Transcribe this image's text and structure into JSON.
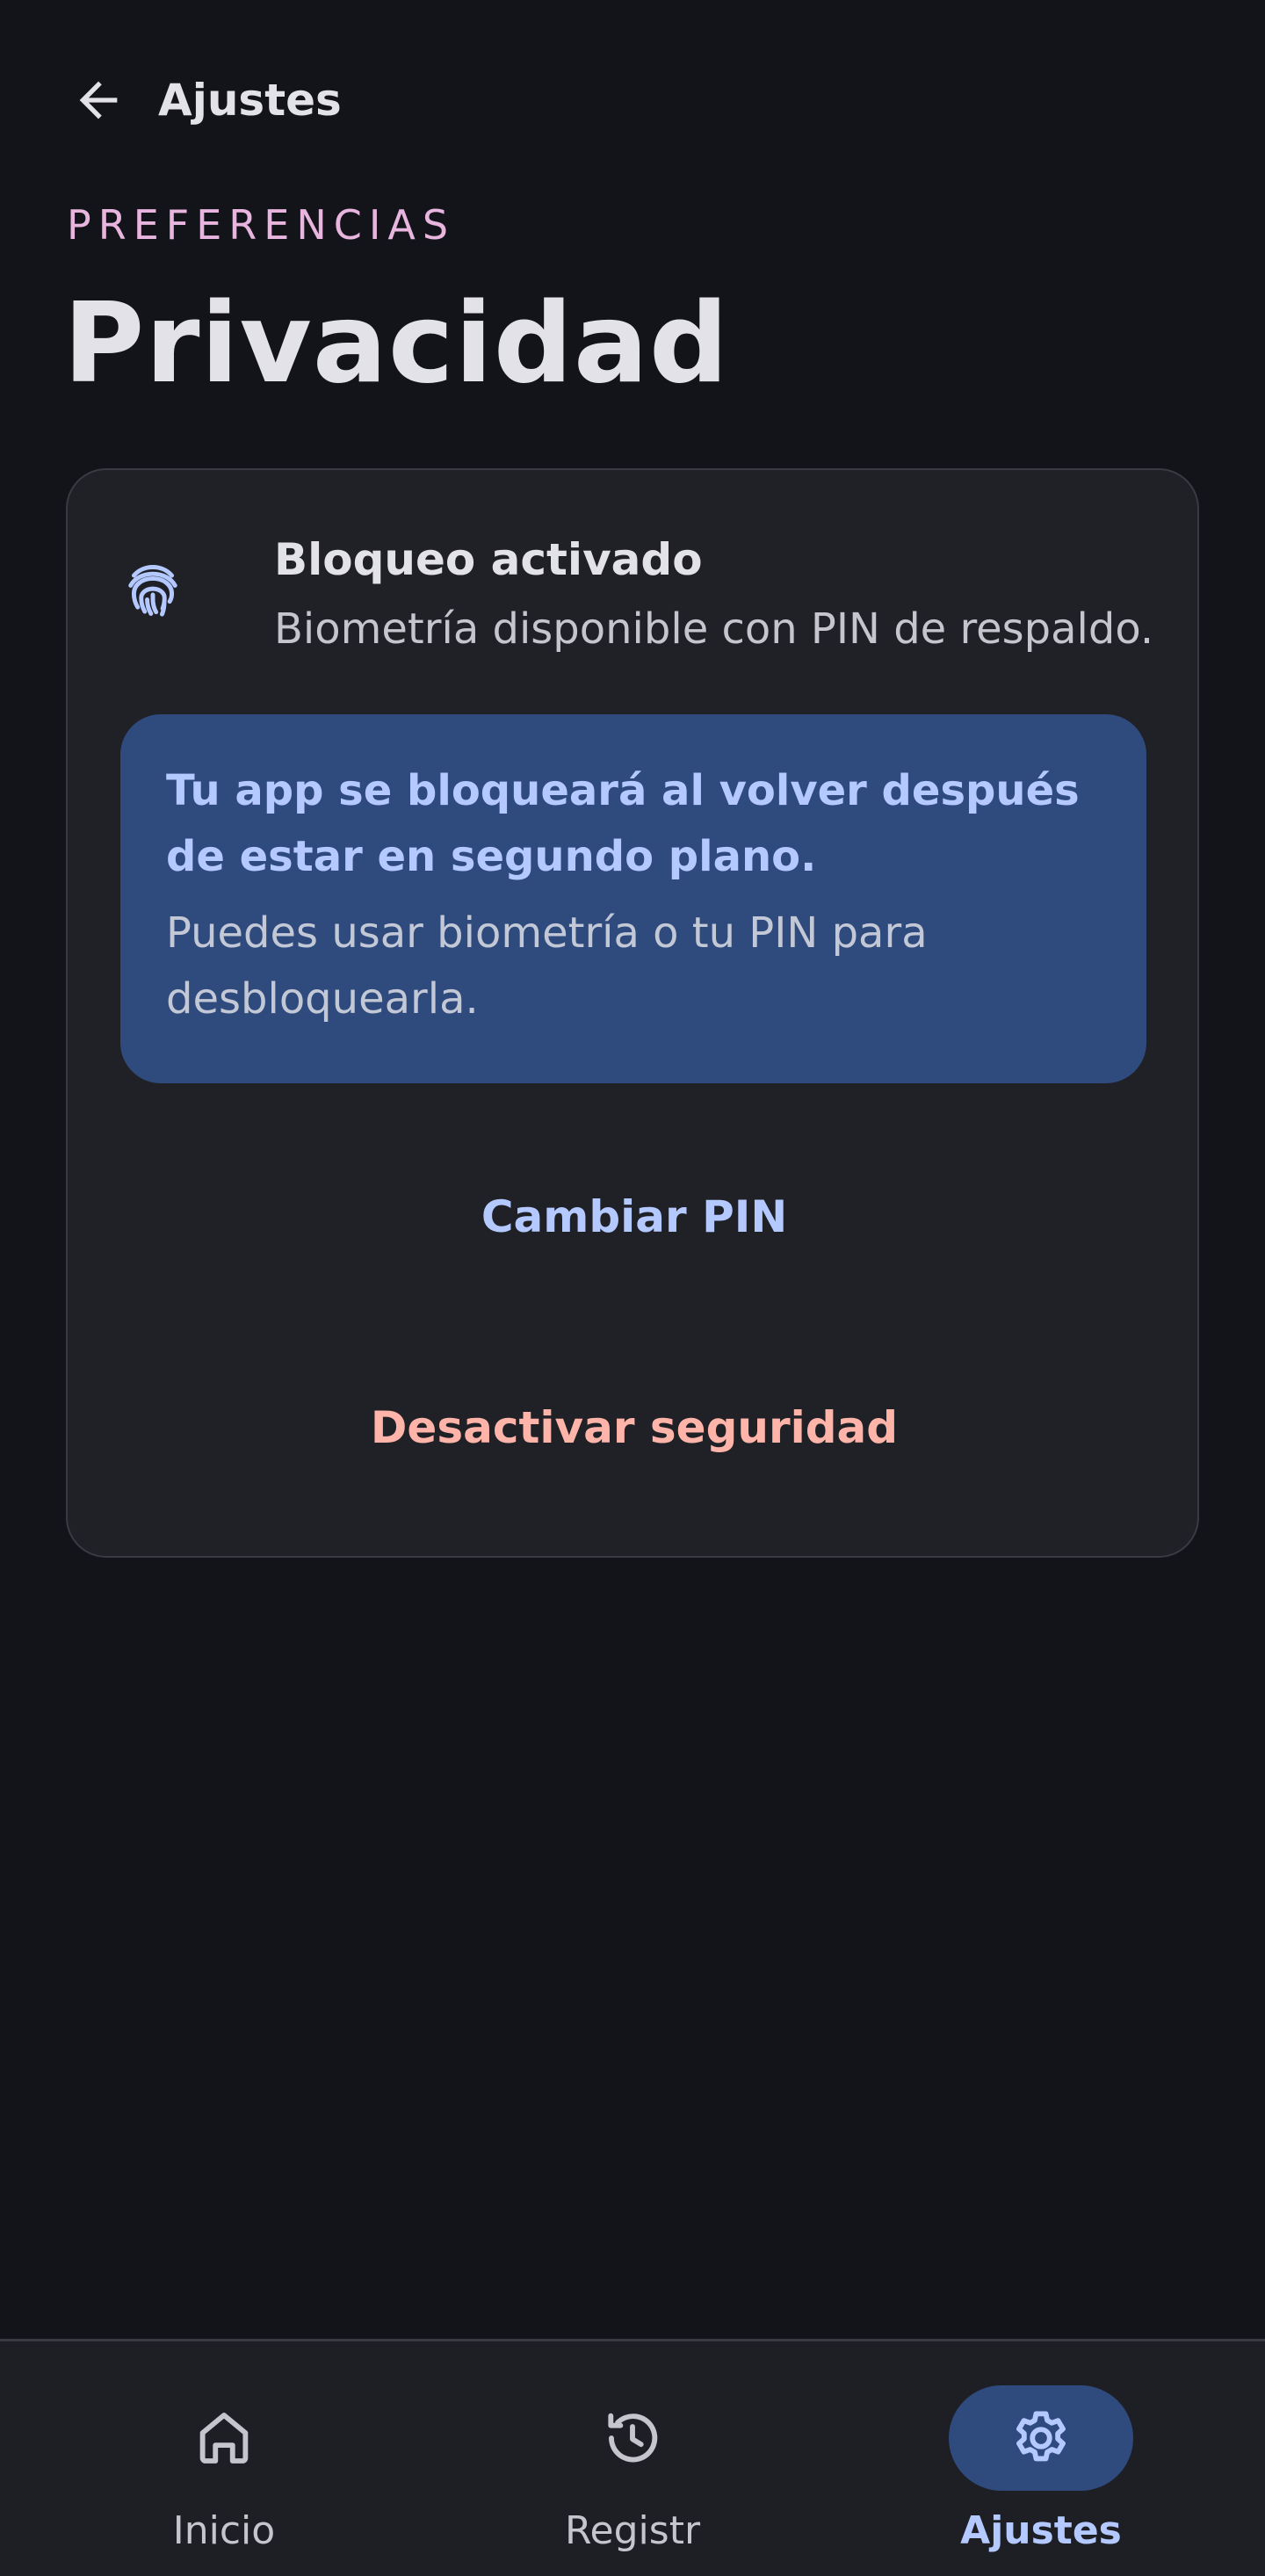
{
  "header": {
    "back_label": "Ajustes",
    "overline": "PREFERENCIAS",
    "title": "Privacidad"
  },
  "card": {
    "status_icon": "fingerprint-icon",
    "status_title": "Bloqueo activado",
    "status_subtitle": "Biometría disponible con PIN de respaldo.",
    "notice_title": "Tu app se bloqueará al volver después de estar en segundo plano.",
    "notice_body": "Puedes usar biometría o tu PIN para desbloquearla.",
    "change_pin_label": "Cambiar PIN",
    "disable_security_label": "Desactivar seguridad"
  },
  "nav": {
    "items": [
      {
        "label": "Inicio",
        "icon": "home-icon",
        "active": false
      },
      {
        "label": "Registr",
        "icon": "history-icon",
        "active": false
      },
      {
        "label": "Ajustes",
        "icon": "gear-icon",
        "active": true
      }
    ]
  },
  "colors": {
    "background": "#131419",
    "surface": "#202127",
    "accent": "#b4c9ff",
    "accent_container": "#2f4a7d",
    "overline": "#e7b5dd",
    "danger": "#ffb4a9"
  }
}
